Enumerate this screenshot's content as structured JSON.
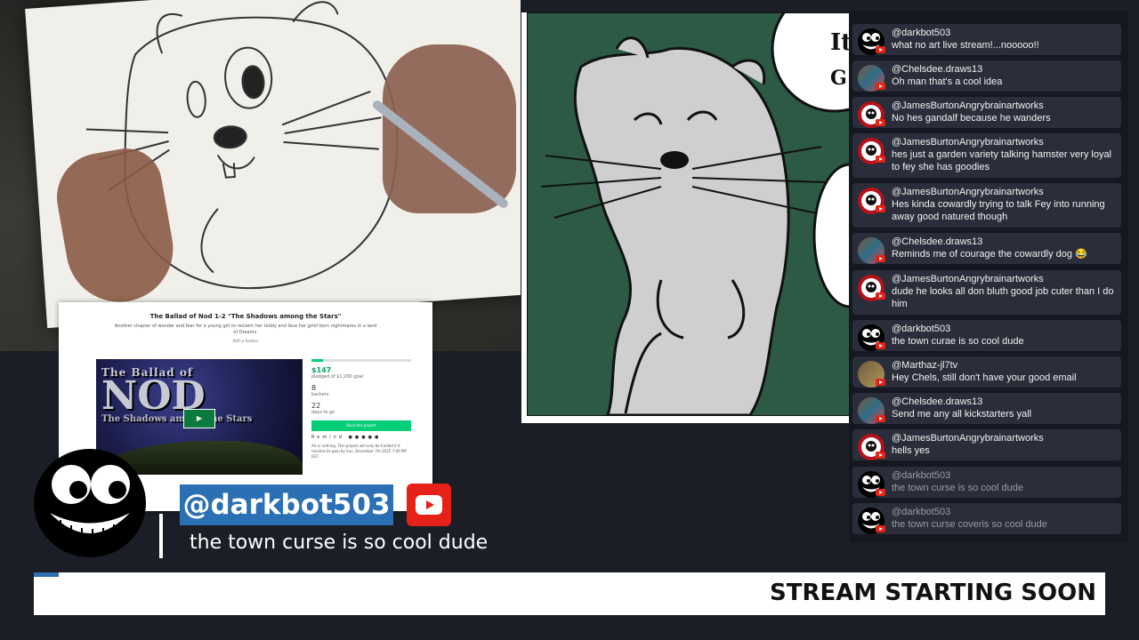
{
  "kickstarter": {
    "title": "The Ballad of Nod 1-2 \"The Shadows among the Stars\"",
    "description": "Another chapter of wonder and fear for a young girl to reclaim her teddy and face her grief born nightmares in a land of Dreams.",
    "author": "With a Kaisher",
    "video_logo_the": "The Ballad of",
    "video_logo_nod": "NOD",
    "video_logo_sub": "The Shadows among the Stars",
    "pledged": "$147",
    "pledged_goal": "pledged of $1,200 goal",
    "backers": "8",
    "backers_label": "backers",
    "days": "22",
    "days_label": "days to go",
    "back_button": "Back this project",
    "share_label": "Remind",
    "footer": "All or nothing. This project will only be funded if it reaches its goal by Sun, December 7th 2025 7:00 PM EST.",
    "progress": 0.12
  },
  "comic": {
    "bubble_1": "It",
    "bubble_2": "G"
  },
  "chat": {
    "messages": [
      {
        "user": "@darkbot503",
        "text": "what no art live stream!...nooooo!!",
        "avatar": "bot",
        "dim": false
      },
      {
        "user": "@Chelsdee.draws13",
        "text": "Oh man that's a cool idea",
        "avatar": "chel",
        "dim": false
      },
      {
        "user": "@JamesBurtonAngrybrainartworks",
        "text": "No hes gandalf because he wanders",
        "avatar": "james",
        "dim": false
      },
      {
        "user": "@JamesBurtonAngrybrainartworks",
        "text": "hes just a garden variety talking hamster very loyal to fey she has goodies",
        "avatar": "james",
        "dim": false
      },
      {
        "user": "@JamesBurtonAngrybrainartworks",
        "text": "Hes kinda cowardly trying to talk Fey into running away good natured though",
        "avatar": "james",
        "dim": false
      },
      {
        "user": "@Chelsdee.draws13",
        "text": "Reminds me of courage the cowardly dog 😂",
        "avatar": "chel",
        "dim": false
      },
      {
        "user": "@JamesBurtonAngrybrainartworks",
        "text": "dude he looks all don bluth good job cuter than I do him",
        "avatar": "james",
        "dim": false
      },
      {
        "user": "@darkbot503",
        "text": "the town curae is so cool dude",
        "avatar": "bot",
        "dim": false
      },
      {
        "user": "@Marthaz-jl7tv",
        "text": "Hey Chels, still don't have your good email",
        "avatar": "martha",
        "dim": false
      },
      {
        "user": "@Chelsdee.draws13",
        "text": "Send me any all kickstarters yall",
        "avatar": "chel",
        "dim": false
      },
      {
        "user": "@JamesBurtonAngrybrainartworks",
        "text": "hells yes",
        "avatar": "james",
        "dim": false
      },
      {
        "user": "@darkbot503",
        "text": "the town curse is so cool dude",
        "avatar": "bot",
        "dim": true
      },
      {
        "user": "@darkbot503",
        "text": "the town curse coveris so cool dude",
        "avatar": "bot",
        "dim": true
      }
    ]
  },
  "highlight": {
    "user": "@darkbot503",
    "text": "the town curse is so cool dude"
  },
  "ticker": {
    "text": "STREAM STARTING SOON"
  },
  "colors": {
    "accent_blue": "#2b6fb4",
    "youtube_red": "#e62117",
    "kickstarter_green": "#05ce78",
    "chat_bg": "#2a2e3a"
  }
}
